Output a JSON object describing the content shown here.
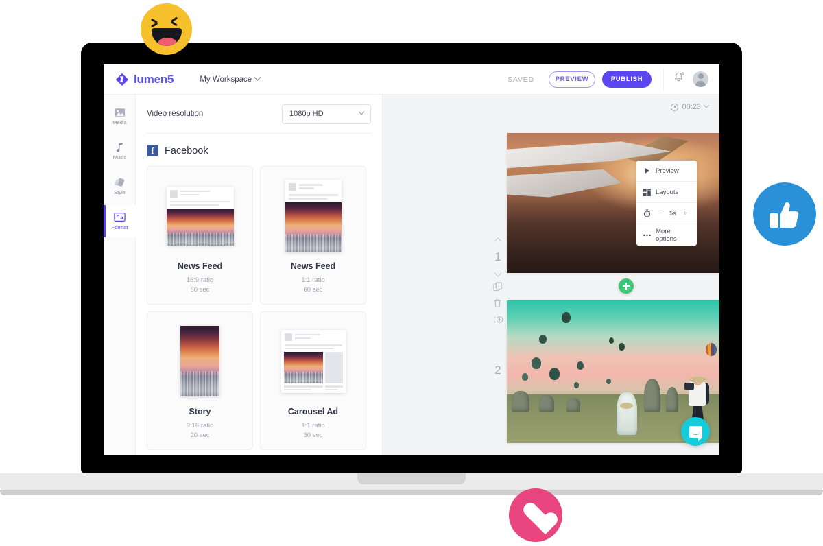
{
  "app": {
    "logo_text": "lumen5",
    "workspace": "My Workspace",
    "saved_label": "SAVED",
    "preview_label": "PREVIEW",
    "publish_label": "PUBLISH",
    "accent_color": "#5b46f0",
    "brand_color": "#5b54e8"
  },
  "sidebar": {
    "items": [
      {
        "label": "Media",
        "icon": "image-icon",
        "active": false
      },
      {
        "label": "Music",
        "icon": "music-note-icon",
        "active": false
      },
      {
        "label": "Style",
        "icon": "palette-icon",
        "active": false
      },
      {
        "label": "Format",
        "icon": "crop-frame-icon",
        "active": true
      }
    ]
  },
  "format_panel": {
    "resolution_label": "Video resolution",
    "resolution_value": "1080p HD",
    "platform": "Facebook",
    "platform_icon": "facebook-icon",
    "platform_glyph": "f",
    "platform_color": "#3b5998",
    "cards": [
      {
        "title": "News Feed",
        "ratio": "16:9 ratio",
        "duration": "60 sec",
        "thumb": "post-landscape"
      },
      {
        "title": "News Feed",
        "ratio": "1:1 ratio",
        "duration": "60 sec",
        "thumb": "post-square"
      },
      {
        "title": "Story",
        "ratio": "9:16 ratio",
        "duration": "20 sec",
        "thumb": "story-vertical"
      },
      {
        "title": "Carousel Ad",
        "ratio": "1:1 ratio",
        "duration": "30 sec",
        "thumb": "post-carousel"
      }
    ]
  },
  "canvas": {
    "timer_value": "00:23",
    "timer_icon": "clock-icon",
    "scenes": [
      {
        "number": "1",
        "image": "airplane-wing-sunset"
      },
      {
        "number": "2",
        "image": "hot-air-balloons-photographers"
      }
    ],
    "rail_icons": [
      "chevron-up-icon",
      "chevron-down-icon",
      "duplicate-icon",
      "trash-icon",
      "add-audio-icon"
    ],
    "add_scene_icon": "plus-icon",
    "scene_tools": {
      "preview_label": "Preview",
      "preview_icon": "play-icon",
      "layouts_label": "Layouts",
      "layouts_icon": "grid-icon",
      "duration_icon": "stopwatch-icon",
      "duration_minus": "−",
      "duration_value": "5s",
      "duration_plus": "+",
      "more_label": "More options",
      "more_icon": "ellipsis-icon"
    },
    "intercom_icon": "chat-bubble-icon",
    "intercom_color": "#15cdd8"
  },
  "decorations": {
    "reactions": [
      {
        "name": "haha-reaction",
        "color": "#f7c12e"
      },
      {
        "name": "like-reaction",
        "color": "#2a90d8"
      },
      {
        "name": "love-reaction",
        "color": "#e8447e"
      }
    ]
  }
}
